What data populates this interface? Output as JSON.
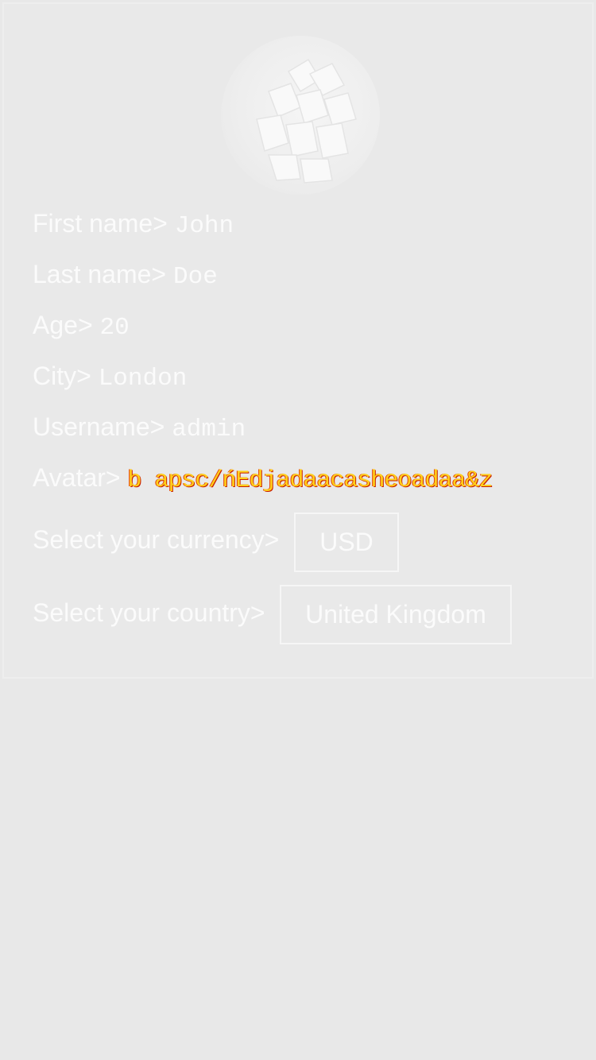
{
  "profile": {
    "avatar_icon": "mango-photo",
    "fields": [
      {
        "label": "First name>",
        "value": "John"
      },
      {
        "label": "Last name>",
        "value": "Doe"
      },
      {
        "label": "Age>",
        "value": "20"
      },
      {
        "label": "City>",
        "value": "London"
      },
      {
        "label": "Username>",
        "value": "admin"
      }
    ],
    "avatar_field": {
      "label": "Avatar>",
      "value": "b apsc/ńEdjadaacasheoadaa&z"
    }
  },
  "currency": {
    "label": "Select your currency>",
    "selected": "USD"
  },
  "country": {
    "label": "Select your country>",
    "selected": "United Kingdom"
  },
  "colors": {
    "background": "#e8e8e8",
    "text": "#fbfbfb",
    "glitch_text": "#ffcf1a",
    "glitch_shadow": "#c81e00"
  }
}
